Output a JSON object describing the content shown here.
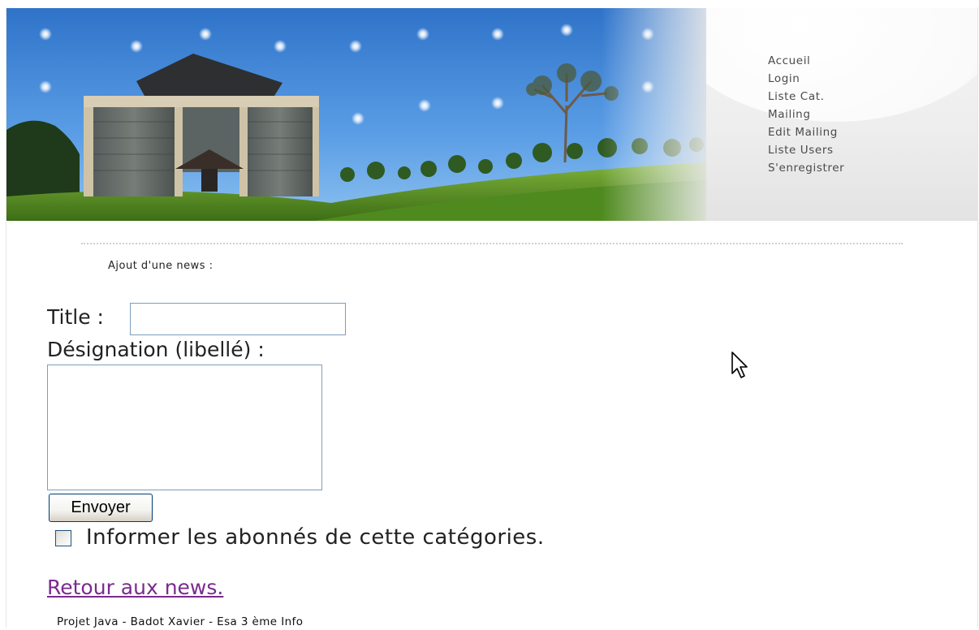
{
  "nav": {
    "items": [
      {
        "label": "Accueil"
      },
      {
        "label": "Login"
      },
      {
        "label": "Liste Cat."
      },
      {
        "label": "Mailing"
      },
      {
        "label": "Edit Mailing"
      },
      {
        "label": "Liste Users"
      },
      {
        "label": "S'enregistrer"
      }
    ]
  },
  "form": {
    "heading": "Ajout d'une news :",
    "title_label": "Title :",
    "title_value": "",
    "designation_label": "Désignation (libellé) :",
    "designation_value": "",
    "submit_label": "Envoyer",
    "notify_label": "Informer les abonnés de cette catégories.",
    "notify_checked": false
  },
  "back_link": "Retour aux news.",
  "footer": "Projet Java - Badot Xavier - Esa 3 ème Info",
  "colors": {
    "link_visited": "#7b2a8f",
    "sky": "#3f86d6",
    "grass": "#5f9a2a"
  },
  "icons": {
    "cursor": "mouse-pointer-icon"
  }
}
